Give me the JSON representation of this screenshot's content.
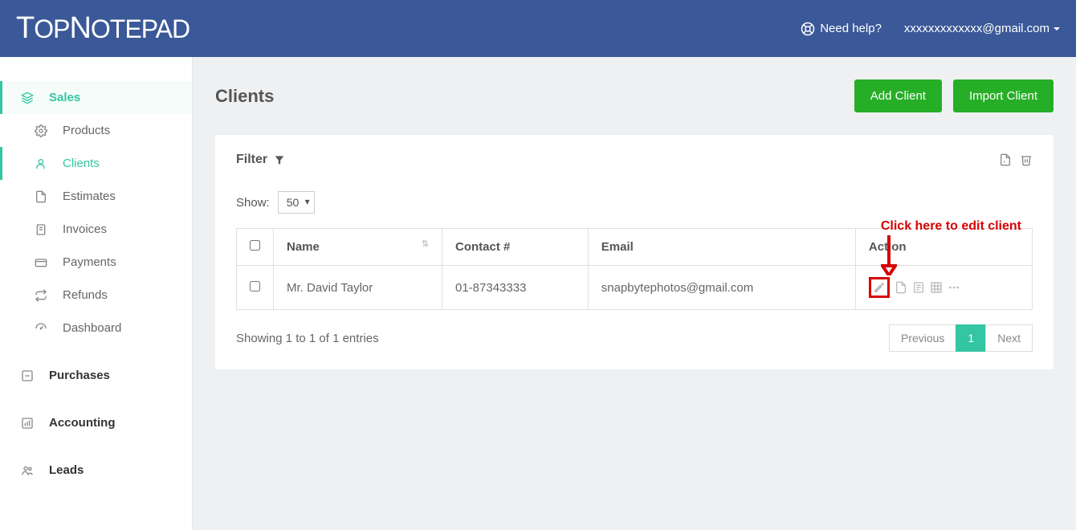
{
  "brand": "TopNotepad",
  "header": {
    "help_label": "Need help?",
    "user_email": "xxxxxxxxxxxxx@gmail.com"
  },
  "sidebar": {
    "sales": {
      "label": "Sales"
    },
    "items": [
      {
        "label": "Products"
      },
      {
        "label": "Clients"
      },
      {
        "label": "Estimates"
      },
      {
        "label": "Invoices"
      },
      {
        "label": "Payments"
      },
      {
        "label": "Refunds"
      },
      {
        "label": "Dashboard"
      }
    ],
    "purchases": {
      "label": "Purchases"
    },
    "accounting": {
      "label": "Accounting"
    },
    "leads": {
      "label": "Leads"
    }
  },
  "page": {
    "title": "Clients",
    "add_button": "Add Client",
    "import_button": "Import Client",
    "filter_label": "Filter",
    "show_label": "Show:",
    "show_value": "50",
    "columns": {
      "name": "Name",
      "contact": "Contact #",
      "email": "Email",
      "action": "Action"
    },
    "rows": [
      {
        "name": "Mr. David Taylor",
        "contact": "01-87343333",
        "email": "snapbytephotos@gmail.com"
      }
    ],
    "entries_info": "Showing 1 to 1 of 1 entries",
    "pagination": {
      "prev": "Previous",
      "current": "1",
      "next": "Next"
    }
  },
  "annotation": {
    "text": "Click here to edit client"
  }
}
